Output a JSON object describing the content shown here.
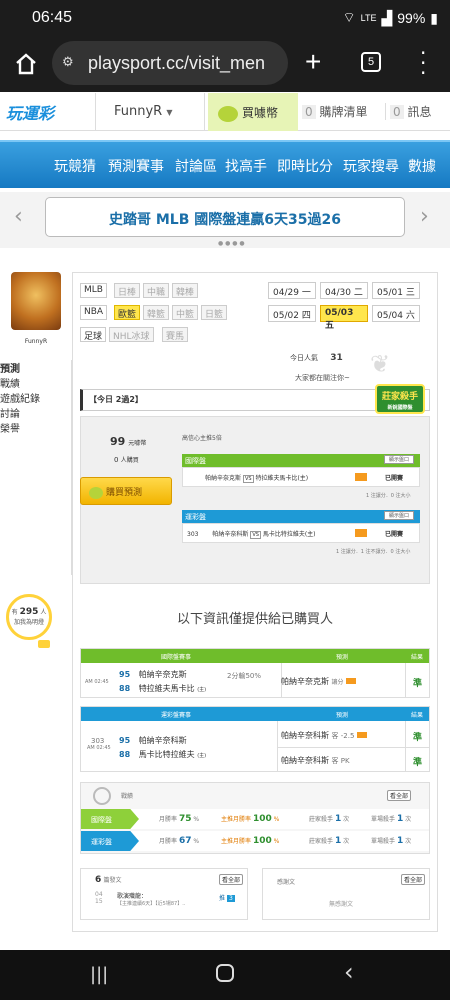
{
  "status": {
    "time": "06:45",
    "signal": "LTE",
    "battery": "99%"
  },
  "browser": {
    "url": "playsport.cc/visit_men",
    "tabs": "5"
  },
  "header": {
    "logo": "玩運彩",
    "user": "FunnyR",
    "buy": "買噱幣",
    "cart_count": "0",
    "cart": "購牌清單",
    "msg_count": "0",
    "msg": "訊息"
  },
  "nav": [
    "玩競猜",
    "預測賽事",
    "討論區",
    "找高手",
    "即時比分",
    "玩家搜尋",
    "數據"
  ],
  "banner": "史踏哥 MLB 國際盤連贏6天35過26",
  "profile": {
    "name": "FunnyR",
    "stat_pre": "有",
    "stat_num": "295",
    "stat_post": "人",
    "stat_line2": "加我為明燈"
  },
  "side": [
    "預測",
    "戰績",
    "遊戲紀錄",
    "討論",
    "榮譽"
  ],
  "leagues": [
    "MLB",
    "日棒",
    "中職",
    "韓棒",
    "NBA",
    "歐籃",
    "韓籃",
    "中籃",
    "日籃",
    "足球",
    "NHL冰球",
    "賽馬"
  ],
  "dates": [
    [
      "04/29",
      "一"
    ],
    [
      "04/30",
      "二"
    ],
    [
      "05/01",
      "三"
    ],
    [
      "05/02",
      "四"
    ],
    [
      "05/03",
      "五"
    ],
    [
      "05/04",
      "六"
    ]
  ],
  "popular": {
    "label": "今日人氣",
    "value": "31",
    "sub": "大家都在關注你~"
  },
  "today": "【今日 2過2】",
  "badge": {
    "title": "莊家殺手",
    "sub": "新銳國際盤"
  },
  "price": {
    "num": "99",
    "unit": "元噱幣",
    "buyers": "0",
    "buyers_unit": "人購買",
    "buy_btn": "購買預測"
  },
  "predicts": {
    "note": "高信心主推5倍",
    "intl": "國際盤",
    "intl_show": "顯示盤口",
    "game1_home": "帕納辛奈克斯",
    "vs": "VS",
    "game1_away": "特拉維夫馬卡比(主)",
    "bought": "已開賽",
    "intl_sum": "1 注讓分．0 注大小",
    "bet": "運彩盤",
    "bet_show": "顯示盤口",
    "game2_no": "303",
    "game2_home": "帕納辛奈科斯",
    "game2_away": "馬卡比特拉維夫(主)",
    "bet_sum": "1 注讓分．1 注不讓分．0 注大小"
  },
  "notice": "以下資訊僅提供給已購買人",
  "intl_table": {
    "h1": "國際盤賽事",
    "h2": "預測",
    "h3": "結果",
    "time": "AM 02:45",
    "n1": "95",
    "t1": "帕納辛奈克斯",
    "n2": "88",
    "t2": "特拉維夫馬卡比",
    "home": "(主)",
    "line": "2分輸50%",
    "pick": "帕納辛奈克斯",
    "pick_type": "讓分",
    "result": "準"
  },
  "bet_table": {
    "h1": "運彩盤賽事",
    "h2": "預測",
    "h3": "結果",
    "no": "303",
    "time": "AM 02:45",
    "n1": "95",
    "t1": "帕納辛奈科斯",
    "n2": "88",
    "t2": "馬卡比特拉維夫",
    "home": "(主)",
    "pick1": "帕納辛奈科斯",
    "pick1_type": "客 -2.5",
    "res1": "準",
    "pick2": "帕納辛奈科斯",
    "pick2_type": "客 PK",
    "res2": "準"
  },
  "record": {
    "title": "戰績",
    "more": "看全部",
    "r1": {
      "name": "國際盤",
      "k1": "月勝率",
      "v1": "75",
      "k2": "主推月勝率",
      "v2": "100",
      "k3": "莊家殺手",
      "v3": "1",
      "k4": "單場殺手",
      "v4": "1",
      "pct": "%",
      "times": "次"
    },
    "r2": {
      "name": "運彩盤",
      "k1": "月勝率",
      "v1": "67",
      "k2": "主推月勝率",
      "v2": "100",
      "k3": "莊家殺手",
      "v3": "1",
      "k4": "單場殺手",
      "v4": "1",
      "pct": "%",
      "times": "次"
    }
  },
  "posts": {
    "count": "6",
    "label": "篇發文",
    "more": "看全部",
    "date1": "04",
    "date2": "15",
    "title": "歌演殲龍：",
    "sub": "【主推連續6天】【近5場87】..",
    "reply": "推",
    "reply_n": "3"
  },
  "reply": {
    "label": "感謝文",
    "more": "看全部",
    "empty": "無感謝文"
  },
  "colors": {
    "nav": "#1679c2",
    "green": "#6fbd2b",
    "blue": "#1e9ad6",
    "highlight": "#ffe64d"
  }
}
